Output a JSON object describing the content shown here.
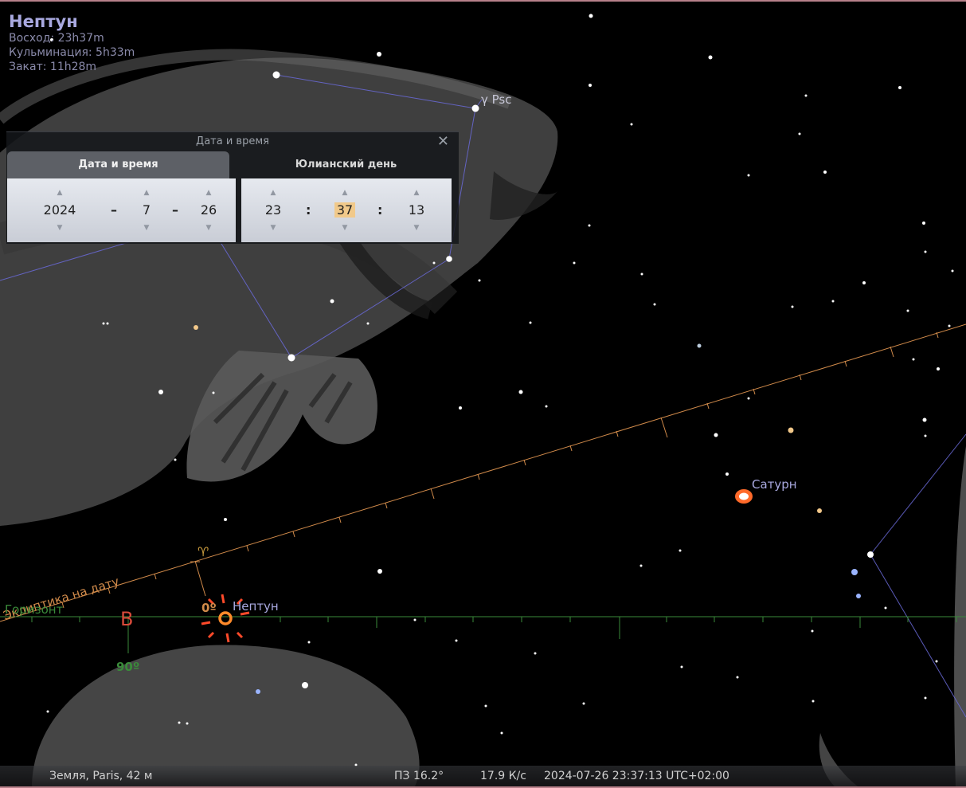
{
  "selected_object": {
    "name": "Нептун",
    "rise": "Восход: 23h37m",
    "transit": "Кульминация: 5h33m",
    "set": "Закат: 11h28m"
  },
  "sky_labels": {
    "gamma_psc": "γ Psc",
    "saturn": "Сатурн",
    "neptune": "Нептун",
    "ecliptic": "Эклиптика на дату",
    "horizon": "Горизонт",
    "cardinal_east": "В",
    "azimuth_90": "90º",
    "ecliptic_zero": "0º",
    "aries_symbol": "♈"
  },
  "colors": {
    "ecliptic": "#d08a4a",
    "horizon": "#3a8a3a",
    "constellation_lines": "#6a6ad8",
    "cardinal": "#d84a3a",
    "marker": "#ff6a2a"
  },
  "dialog": {
    "title": "Дата и время",
    "tabs": {
      "datetime": "Дата и время",
      "julian": "Юлианский день"
    },
    "date": {
      "year": "2024",
      "month": "7",
      "day": "26",
      "sep": "–"
    },
    "time": {
      "hour": "23",
      "minute": "37",
      "second": "13",
      "sep": ":"
    },
    "spin_up": "▲",
    "spin_down": "▼",
    "close": "✕"
  },
  "status_bar": {
    "location": "Земля, Paris, 42 м",
    "fov": "ПЗ 16.2°",
    "fps": "17.9 К/с",
    "datetime": "2024-07-26 23:37:13 UTC+02:00"
  }
}
